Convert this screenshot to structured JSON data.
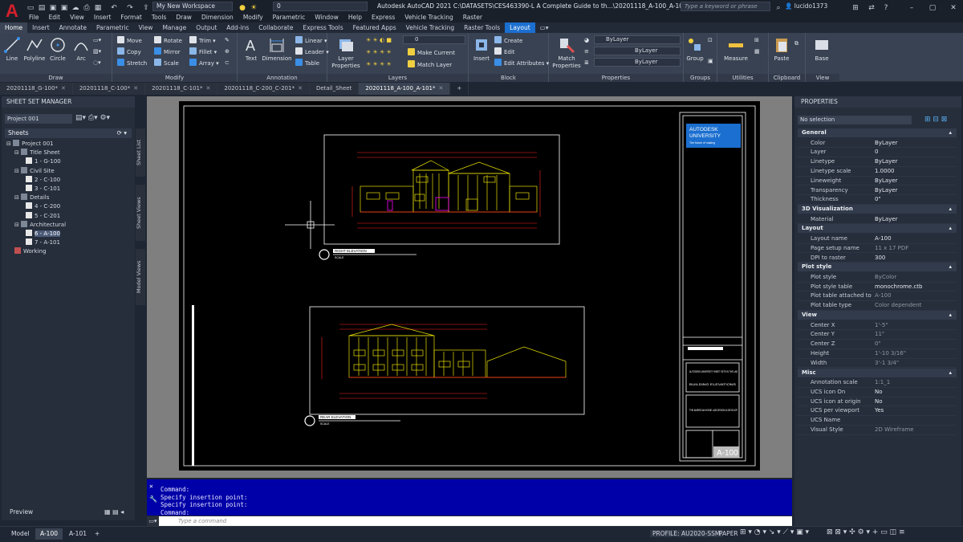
{
  "titlebar": {
    "workspace": "My New Workspace",
    "layer_combo": "0",
    "title": "Autodesk AutoCAD 2021   C:\\DATASETS\\CES463390-L A Complete Guide to th...\\20201118_A-100_A-101.dwg",
    "search_placeholder": "Type a keyword or phrase",
    "username": "lucido1373",
    "menu": [
      "File",
      "Edit",
      "View",
      "Insert",
      "Format",
      "Tools",
      "Draw",
      "Dimension",
      "Modify",
      "Parametric",
      "Window",
      "Help",
      "Express",
      "Vehicle Tracking",
      "Raster"
    ]
  },
  "ribbon_tabs": [
    "Home",
    "Insert",
    "Annotate",
    "Parametric",
    "View",
    "Manage",
    "Output",
    "Add-ins",
    "Collaborate",
    "Express Tools",
    "Featured Apps",
    "Vehicle Tracking",
    "Raster Tools",
    "Layout"
  ],
  "ribbon": {
    "draw": {
      "label": "Draw",
      "line": "Line",
      "polyline": "Polyline",
      "circle": "Circle",
      "arc": "Arc"
    },
    "modify": {
      "label": "Modify",
      "move": "Move",
      "copy": "Copy",
      "stretch": "Stretch",
      "rotate": "Rotate",
      "mirror": "Mirror",
      "scale": "Scale",
      "trim": "Trim",
      "fillet": "Fillet",
      "array": "Array"
    },
    "annotation": {
      "label": "Annotation",
      "text": "Text",
      "dimension": "Dimension",
      "linear": "Linear",
      "leader": "Leader",
      "table": "Table"
    },
    "layers": {
      "label": "Layers",
      "layer_properties": "Layer Properties",
      "layer_value": "0",
      "make_current": "Make Current",
      "match_layer": "Match Layer"
    },
    "block": {
      "label": "Block",
      "insert": "Insert",
      "create": "Create",
      "edit": "Edit",
      "edit_attributes": "Edit Attributes"
    },
    "properties": {
      "label": "Properties",
      "match_properties": "Match Properties",
      "color": "ByLayer",
      "linetype": "ByLayer",
      "lineweight": "ByLayer"
    },
    "groups": {
      "label": "Groups",
      "group": "Group"
    },
    "utilities": {
      "label": "Utilities",
      "measure": "Measure"
    },
    "clipboard": {
      "label": "Clipboard",
      "paste": "Paste"
    },
    "view": {
      "label": "View",
      "base": "Base"
    }
  },
  "doc_tabs": [
    "20201118_G-100*",
    "20201118_C-100*",
    "20201118_C-101*",
    "20201118_C-200_C-201*",
    "Detail_Sheet",
    "20201118_A-100_A-101*"
  ],
  "ssm": {
    "title": "SHEET SET MANAGER",
    "project_combo": "Project 001",
    "sheets_label": "Sheets",
    "tree": [
      {
        "label": "Project 001",
        "level": 0
      },
      {
        "label": "Title Sheet",
        "level": 1
      },
      {
        "label": "1 - G-100",
        "level": 2
      },
      {
        "label": "Civil Site",
        "level": 1
      },
      {
        "label": "2 - C-100",
        "level": 2
      },
      {
        "label": "3 - C-101",
        "level": 2
      },
      {
        "label": "Details",
        "level": 1
      },
      {
        "label": "4 - C-200",
        "level": 2
      },
      {
        "label": "5 - C-201",
        "level": 2
      },
      {
        "label": "Architectural",
        "level": 1
      },
      {
        "label": "6 - A-100",
        "level": 2,
        "selected": true
      },
      {
        "label": "7 - A-101",
        "level": 2
      },
      {
        "label": "Working",
        "level": 1
      }
    ],
    "preview": "Preview",
    "side_tabs": [
      "Sheet List",
      "Sheet Views",
      "Model Views"
    ]
  },
  "drawing": {
    "elev1_label": "RIGHT ELEVATION",
    "elev2_label": "REAR ELEVATION",
    "scale_label": "SCALE",
    "logo_line1": "AUTODESK",
    "logo_line2": "UNIVERSITY",
    "logo_tag": "The future of making",
    "tb_project": "AUTODESK UNIVERSITY SHEET SETS IN THE LAB",
    "tb_title": "BUILDING ELEVATIONS",
    "tb_firm": "THE AMERICAN HOME LAB DESIGN & DEVELOP",
    "sheet_number": "A-100"
  },
  "command": {
    "history": [
      "Command:",
      "Specify insertion point:",
      "Specify insertion point:",
      "Command:"
    ],
    "placeholder": "Type a command"
  },
  "properties": {
    "title": "PROPERTIES",
    "selection": "No selection",
    "sections": [
      {
        "name": "General",
        "rows": [
          [
            "Color",
            "ByLayer"
          ],
          [
            "Layer",
            "0"
          ],
          [
            "Linetype",
            "ByLayer"
          ],
          [
            "Linetype scale",
            "1.0000"
          ],
          [
            "Lineweight",
            "ByLayer"
          ],
          [
            "Transparency",
            "ByLayer"
          ],
          [
            "Thickness",
            "0\""
          ]
        ]
      },
      {
        "name": "3D Visualization",
        "rows": [
          [
            "Material",
            "ByLayer"
          ]
        ]
      },
      {
        "name": "Layout",
        "rows": [
          [
            "Layout name",
            "A-100"
          ],
          [
            "Page setup name",
            "11 x 17 PDF"
          ],
          [
            "DPI to raster",
            "300"
          ]
        ]
      },
      {
        "name": "Plot style",
        "rows": [
          [
            "Plot style",
            "ByColor"
          ],
          [
            "Plot style table",
            "monochrome.ctb"
          ],
          [
            "Plot table attached to",
            "A-100"
          ],
          [
            "Plot table type",
            "Color dependent"
          ]
        ]
      },
      {
        "name": "View",
        "rows": [
          [
            "Center X",
            "1'-5\""
          ],
          [
            "Center Y",
            "11\""
          ],
          [
            "Center Z",
            "0\""
          ],
          [
            "Height",
            "1'-10 3/16\""
          ],
          [
            "Width",
            "3'-1 3/4\""
          ]
        ]
      },
      {
        "name": "Misc",
        "rows": [
          [
            "Annotation scale",
            "1:1_1"
          ],
          [
            "UCS icon On",
            "No"
          ],
          [
            "UCS icon at origin",
            "No"
          ],
          [
            "UCS per viewport",
            "Yes"
          ],
          [
            "UCS Name",
            ""
          ],
          [
            "Visual Style",
            "2D Wireframe"
          ]
        ]
      }
    ]
  },
  "status": {
    "tabs": [
      "Model",
      "A-100",
      "A-101"
    ],
    "profile": "PROFILE: AU2020-SSM",
    "paper": "PAPER"
  },
  "colors": {
    "accent": "#1b6fd0",
    "command_bg": "#0000a8",
    "cad_red": "#ff2020",
    "cad_yellow": "#e8e000",
    "cad_magenta": "#ff00ff"
  }
}
